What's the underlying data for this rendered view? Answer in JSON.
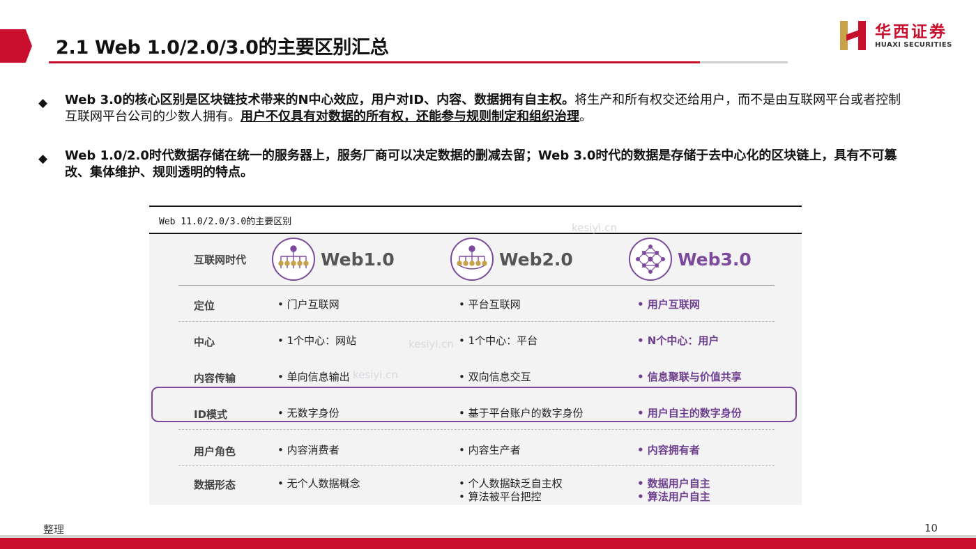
{
  "header": {
    "title": "2.1 Web 1.0/2.0/3.0的主要区别汇总",
    "logo_cn": "华西证券",
    "logo_en": "HUAXI SECURITIES"
  },
  "bullets": [
    {
      "bold": "Web 3.0的核心区别是区块链技术带来的N中心效应，用户对ID、内容、数据拥有自主权。",
      "normal": "将生产和所有权交还给用户，而不是由互联网平台或者控制互联网平台公司的少数人拥有。",
      "underline": "用户不仅具有对数据的所有权，还能参与规则制定和组织治理",
      "end": "。"
    },
    {
      "bold": "Web 1.0/2.0时代数据存储在统一的服务器上，服务厂商可以决定数据的删减去留；Web 3.0时代的数据是存储于去中心化的区块链上，具有不可篡改、集体维护、规则透明的特点。"
    }
  ],
  "figure": {
    "caption": "Web 11.0/2.0/3.0的主要区别",
    "header_label": "互联网时代",
    "eras": [
      "Web1.0",
      "Web2.0",
      "Web3.0"
    ],
    "rows": [
      {
        "label": "定位",
        "c1": "• 门户互联网",
        "c2": "• 平台互联网",
        "c3": "• 用户互联网"
      },
      {
        "label": "中心",
        "c1": "• 1个中心：网站",
        "c2": "• 1个中心：平台",
        "c3": "• N个中心：用户"
      },
      {
        "label": "内容传输",
        "c1": "• 单向信息输出",
        "c2": "• 双向信息交互",
        "c3": "• 信息聚联与价值共享"
      },
      {
        "label": "ID模式",
        "c1": "• 无数字身份",
        "c2": "• 基于平台账户的数字身份",
        "c3": "• 用户自主的数字身份"
      },
      {
        "label": "用户角色",
        "c1": "• 内容消费者",
        "c2": "• 内容生产者",
        "c3": "• 内容拥有者"
      },
      {
        "label": "数据形态",
        "c1": "• 无个人数据概念",
        "c2": "• 个人数据缺乏自主权",
        "c2b": "• 算法被平台把控",
        "c3": "• 数据用户自主",
        "c3b": "• 算法用户自主"
      }
    ],
    "watermark": "kesiyi.cn"
  },
  "footer": {
    "source": "整理",
    "page": "10"
  },
  "colors": {
    "brand_red": "#c8102e",
    "accent_purple": "#7b4a9b",
    "gold": "#c8a24a"
  }
}
